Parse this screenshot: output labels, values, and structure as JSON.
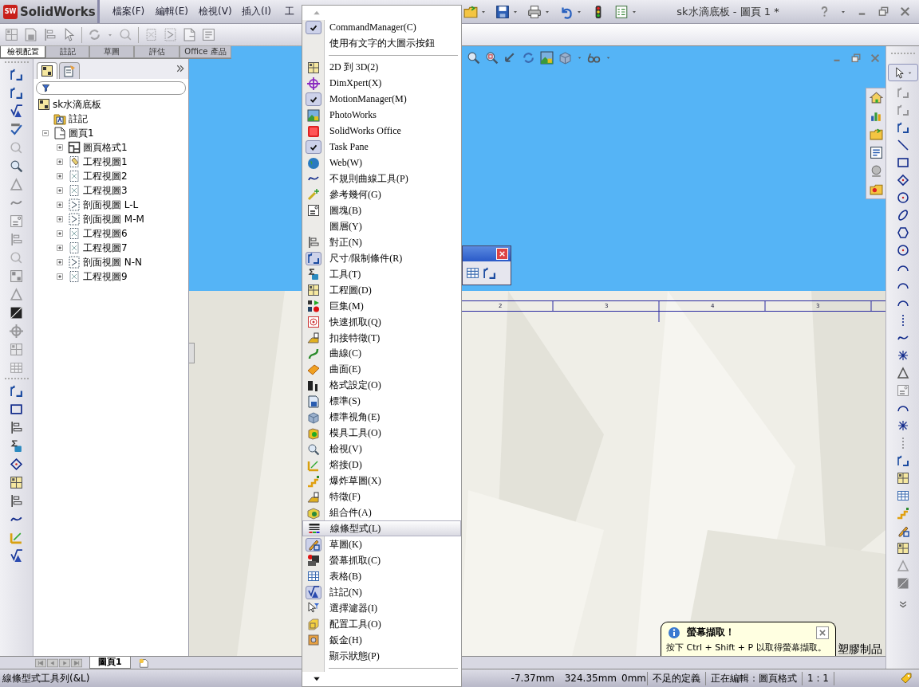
{
  "title_bar": {
    "logo_text": "SW",
    "app_name": "SolidWorks",
    "menus": [
      "檔案(F)",
      "編輯(E)",
      "檢視(V)",
      "插入(I)",
      "工"
    ],
    "document_title": "sk水滴底板 - 圖頁 1 *"
  },
  "command_manager_tabs": [
    {
      "label": "檢視配置",
      "selected": true
    },
    {
      "label": "註記",
      "selected": false
    },
    {
      "label": "草圖",
      "selected": false
    },
    {
      "label": "評估",
      "selected": false
    },
    {
      "label": "Office 產品",
      "selected": false
    }
  ],
  "feature_tree": {
    "root": {
      "label": "sk水滴底板",
      "kind": "drawing",
      "children": [
        {
          "label": "註記",
          "kind": "annotations"
        },
        {
          "label": "圖頁1",
          "kind": "sheet",
          "expanded": true,
          "children": [
            {
              "label": "圖頁格式1",
              "kind": "sheet_format",
              "expanded": false
            },
            {
              "label": "工程視圖1",
              "kind": "model_view",
              "expanded": false
            },
            {
              "label": "工程視圖2",
              "kind": "view",
              "expanded": false
            },
            {
              "label": "工程視圖3",
              "kind": "view",
              "expanded": false
            },
            {
              "label": "剖面視圖 L-L",
              "kind": "section_view",
              "expanded": false
            },
            {
              "label": "剖面視圖 M-M",
              "kind": "section_view",
              "expanded": false
            },
            {
              "label": "工程視圖6",
              "kind": "view",
              "expanded": false
            },
            {
              "label": "工程視圖7",
              "kind": "view",
              "expanded": false
            },
            {
              "label": "剖面視圖 N-N",
              "kind": "section_view",
              "expanded": false
            },
            {
              "label": "工程視圖9",
              "kind": "view",
              "expanded": false
            }
          ]
        }
      ]
    }
  },
  "drawing": {
    "zone_labels": [
      "2",
      "3",
      "4",
      "3"
    ],
    "title_block_text": "塑膠制品"
  },
  "tooltip": {
    "title": "螢幕擷取！",
    "text": "按下 Ctrl + Shift + P 以取得螢幕擷取。"
  },
  "sheet_tabs": [
    {
      "label": "圖頁1",
      "selected": true
    }
  ],
  "status_bar": {
    "message": "線條型式工具列(&L)",
    "coordinates": [
      "-7.37mm",
      "324.35mm",
      "0mm"
    ],
    "definition": "不足的定義",
    "editing": "正在編輯：圖頁格式",
    "scale": "1 : 1"
  },
  "context_menu": {
    "items": [
      {
        "label": "CommandManager(C)",
        "checked": true,
        "selected": false
      },
      {
        "label": "使用有文字的大圖示按鈕",
        "checked": false,
        "selected": false
      },
      {
        "label": "2D 到 3D(2)",
        "checked": false,
        "selected": false
      },
      {
        "label": "DimXpert(X)",
        "checked": false,
        "selected": false
      },
      {
        "label": "MotionManager(M)",
        "checked": true,
        "selected": false
      },
      {
        "label": "PhotoWorks",
        "checked": false,
        "selected": false
      },
      {
        "label": "SolidWorks Office",
        "checked": false,
        "selected": false
      },
      {
        "label": "Task Pane",
        "checked": true,
        "selected": false
      },
      {
        "label": "Web(W)",
        "checked": false,
        "selected": false
      },
      {
        "label": "不規則曲線工具(P)",
        "checked": false,
        "selected": false
      },
      {
        "label": "參考幾何(G)",
        "checked": false,
        "selected": false
      },
      {
        "label": "圖塊(B)",
        "checked": false,
        "selected": false
      },
      {
        "label": "圖層(Y)",
        "checked": false,
        "selected": false
      },
      {
        "label": "對正(N)",
        "checked": false,
        "selected": false
      },
      {
        "label": "尺寸/限制條件(R)",
        "checked": true,
        "selected": false
      },
      {
        "label": "工具(T)",
        "checked": false,
        "selected": false
      },
      {
        "label": "工程圖(D)",
        "checked": false,
        "selected": false
      },
      {
        "label": "巨集(M)",
        "checked": false,
        "selected": false
      },
      {
        "label": "快速抓取(Q)",
        "checked": false,
        "selected": false
      },
      {
        "label": "扣接特徵(T)",
        "checked": false,
        "selected": false
      },
      {
        "label": "曲線(C)",
        "checked": false,
        "selected": false
      },
      {
        "label": "曲面(E)",
        "checked": false,
        "selected": false
      },
      {
        "label": "格式設定(O)",
        "checked": false,
        "selected": false
      },
      {
        "label": "標準(S)",
        "checked": false,
        "selected": false
      },
      {
        "label": "標準視角(E)",
        "checked": false,
        "selected": false
      },
      {
        "label": "模具工具(O)",
        "checked": false,
        "selected": false
      },
      {
        "label": "檢視(V)",
        "checked": false,
        "selected": false
      },
      {
        "label": "熔接(D)",
        "checked": false,
        "selected": false
      },
      {
        "label": "爆炸草圖(X)",
        "checked": false,
        "selected": false
      },
      {
        "label": "特徵(F)",
        "checked": false,
        "selected": false
      },
      {
        "label": "組合件(A)",
        "checked": false,
        "selected": false
      },
      {
        "label": "線條型式(L)",
        "checked": false,
        "selected": true
      },
      {
        "label": "草圖(K)",
        "checked": true,
        "selected": false
      },
      {
        "label": "螢幕抓取(C)",
        "checked": false,
        "selected": false
      },
      {
        "label": "表格(B)",
        "checked": false,
        "selected": false
      },
      {
        "label": "註記(N)",
        "checked": true,
        "selected": false
      },
      {
        "label": "選擇濾器(I)",
        "checked": false,
        "selected": false
      },
      {
        "label": "配置工具(O)",
        "checked": false,
        "selected": false
      },
      {
        "label": "鈑金(H)",
        "checked": false,
        "selected": false
      },
      {
        "label": "顯示狀態(P)",
        "checked": false,
        "selected": false
      }
    ]
  }
}
